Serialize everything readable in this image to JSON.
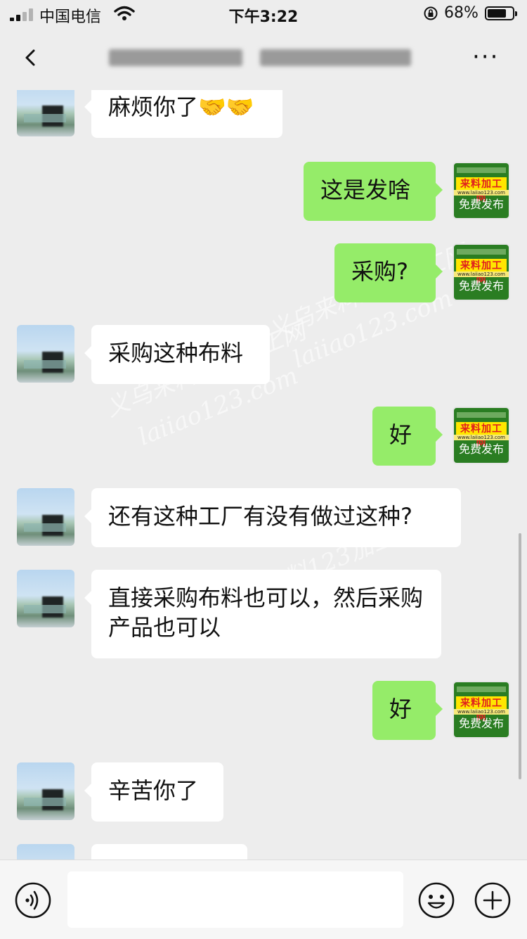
{
  "status_bar": {
    "carrier": "中国电信",
    "time": "下午3:22",
    "battery_text": "68%",
    "battery_level": 0.68
  },
  "header": {
    "more_label": "···"
  },
  "messages": [
    {
      "side": "in",
      "text": "麻烦你了🤝🤝"
    },
    {
      "side": "out",
      "text": "这是发啥"
    },
    {
      "side": "out",
      "text": "采购?"
    },
    {
      "side": "in",
      "text": "采购这种布料"
    },
    {
      "side": "out",
      "text": "好"
    },
    {
      "side": "in",
      "text": "还有这种工厂有没有做过这种?"
    },
    {
      "side": "in",
      "text": "直接采购布料也可以，然后采购产品也可以"
    },
    {
      "side": "out",
      "text": "好"
    },
    {
      "side": "in",
      "text": "辛苦你了"
    }
  ],
  "my_avatar": {
    "brand": "来料加工网",
    "url": "www.laiiao123.com",
    "slogan": "免费发布"
  },
  "watermark": {
    "line1": "义乌来料123加工网",
    "line2": "laiiao123.com"
  },
  "input": {
    "value": "",
    "placeholder": ""
  },
  "colors": {
    "outgoing_bubble": "#95ec69",
    "incoming_bubble": "#ffffff",
    "background": "#ededed"
  }
}
